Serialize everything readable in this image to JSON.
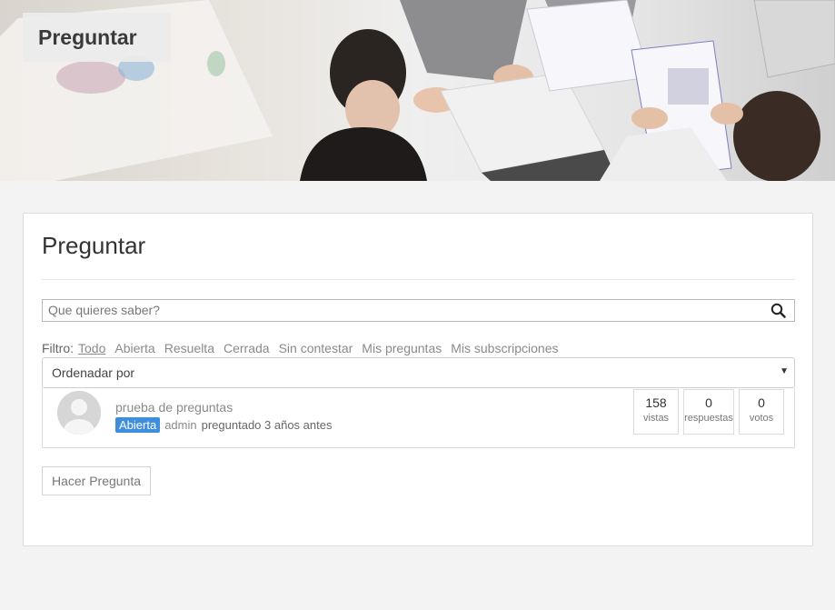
{
  "banner": {
    "title": "Preguntar"
  },
  "page": {
    "title": "Preguntar"
  },
  "search": {
    "placeholder": "Que quieres saber?"
  },
  "filters": {
    "label": "Filtro:",
    "items": [
      "Todo",
      "Abierta",
      "Resuelta",
      "Cerrada",
      "Sin contestar",
      "Mis preguntas",
      "Mis subscripciones"
    ]
  },
  "sort": {
    "label": "Ordenadar por"
  },
  "question": {
    "title": "prueba de preguntas",
    "status": "Abierta",
    "author": "admin",
    "asked": "preguntado 3 años antes",
    "stats": {
      "views": {
        "value": "158",
        "label": "vistas"
      },
      "answers": {
        "value": "0",
        "label": "respuestas"
      },
      "votes": {
        "value": "0",
        "label": "votos"
      }
    }
  },
  "actions": {
    "ask": "Hacer Pregunta"
  },
  "colors": {
    "badge": "#3e8ee0",
    "background": "#f3f3f3"
  }
}
